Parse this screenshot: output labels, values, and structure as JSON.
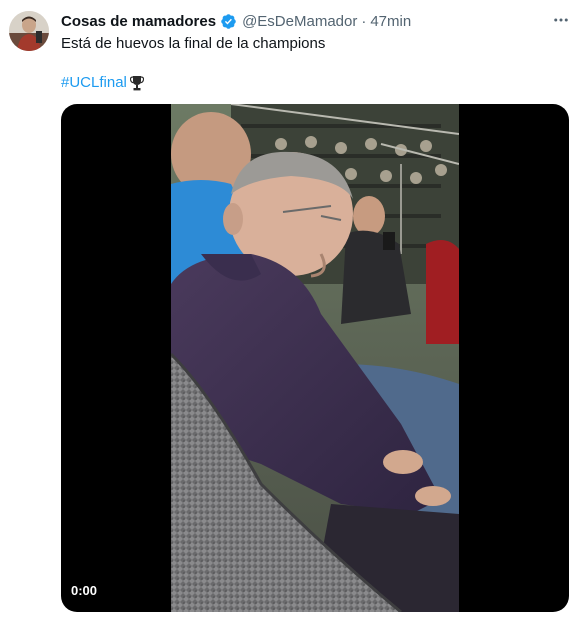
{
  "tweet": {
    "display_name": "Cosas de mamadores",
    "verified": true,
    "handle": "@EsDeMamador",
    "separator": "·",
    "time": "47min",
    "text": "Está de huevos la final de la champions",
    "hashtag": "#UCLfinal",
    "icons": {
      "verified": "verified-badge-icon",
      "more": "more-options-icon",
      "trophy": "trophy-emoji-icon"
    },
    "colors": {
      "accent": "#1d9bf0",
      "text": "#0f1419",
      "secondary": "#536471"
    }
  },
  "media": {
    "type": "video",
    "timer": "0:00"
  }
}
